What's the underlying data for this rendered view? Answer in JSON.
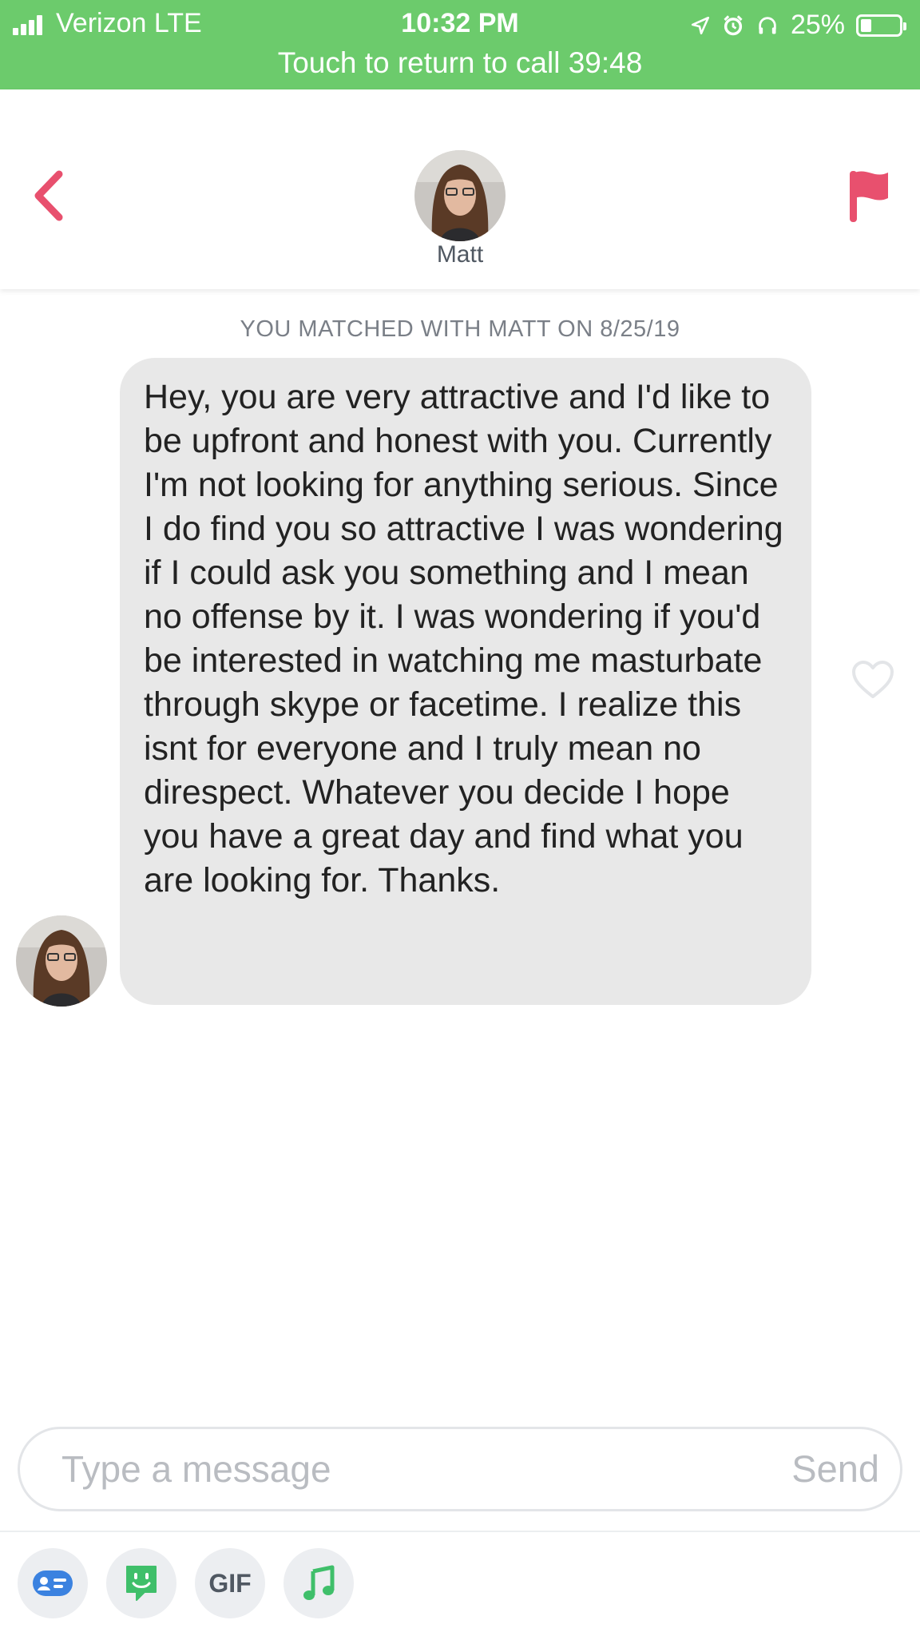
{
  "status_bar": {
    "carrier": "Verizon  LTE",
    "time": "10:32 PM",
    "battery": "25%",
    "battery_level": 0.25,
    "call_banner": "Touch to return to call 39:48",
    "color": "#6ccb6c"
  },
  "header": {
    "name": "Matt",
    "back_icon": "chevron-left-icon",
    "flag_icon": "flag-icon",
    "accent": "#e8506e"
  },
  "chat": {
    "match_note": "YOU MATCHED WITH MATT ON 8/25/19",
    "messages": [
      {
        "text": "Hey, you are very attractive and I'd like to be upfront and honest with you. Currently I'm not looking for anything serious. Since I do find you so attractive I was wondering if I could ask you something and I mean no offense by it. I was wondering if you'd be interested in watching me masturbate through skype or facetime. I realize this isnt for everyone and I truly mean no direspect. Whatever you decide I hope you have a great day and find what you are looking for. Thanks."
      }
    ]
  },
  "composer": {
    "placeholder": "Type a message",
    "send_label": "Send"
  },
  "toolbar": {
    "gif_label": "GIF",
    "items": [
      "contact-card-icon",
      "sticker-icon",
      "gif-icon",
      "music-note-icon"
    ]
  }
}
